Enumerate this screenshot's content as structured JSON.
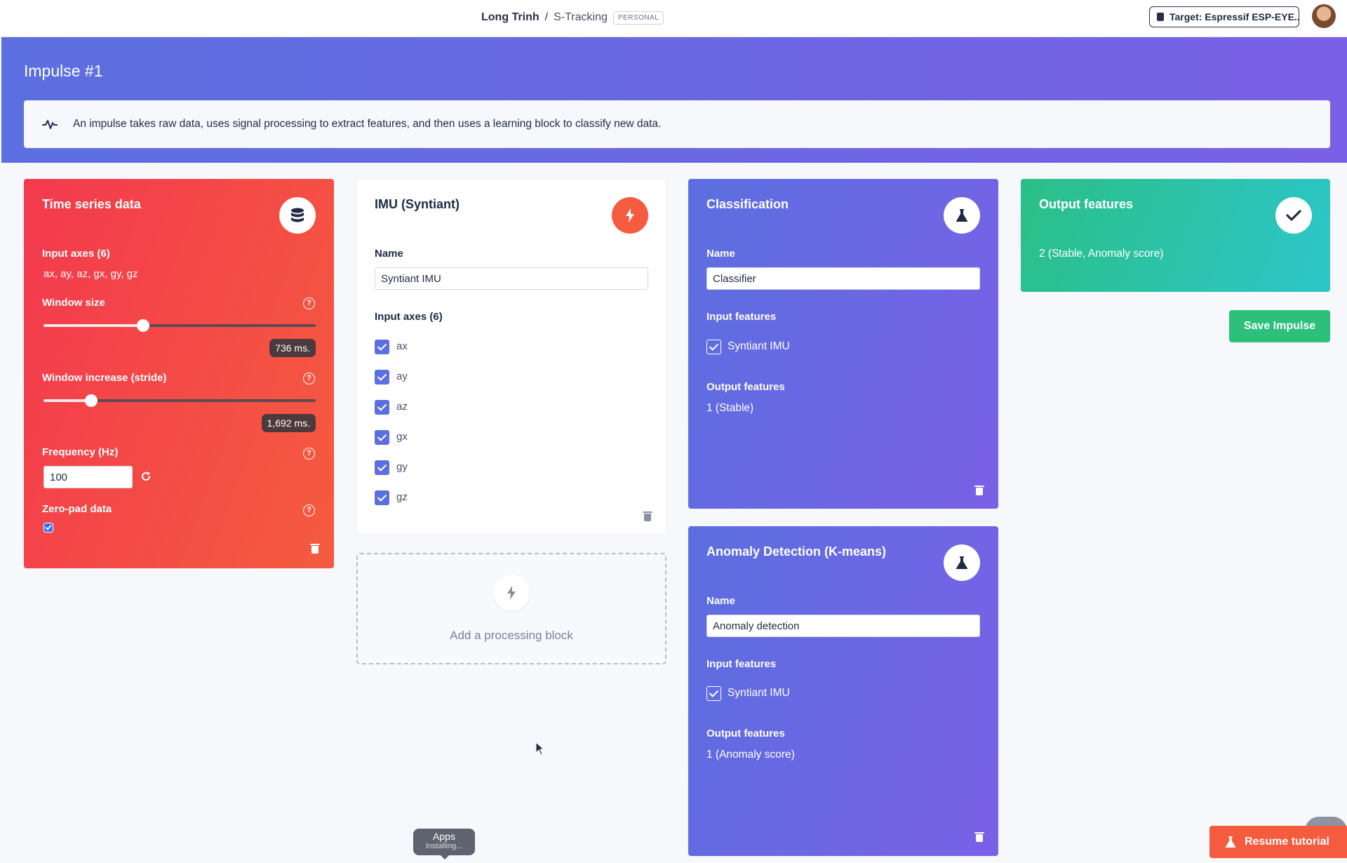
{
  "topbar": {
    "owner": "Long Trinh",
    "separator": "/",
    "project": "S-Tracking",
    "plan_badge": "PERSONAL",
    "target_label": "Target: Espressif ESP-EYE..."
  },
  "header": {
    "title": "Impulse #1",
    "info": "An impulse takes raw data, uses signal processing to extract features, and then uses a learning block to classify new data."
  },
  "time_series": {
    "title": "Time series data",
    "icon": "database-icon",
    "input_axes_label": "Input axes (6)",
    "input_axes_value": "ax, ay, az, gx, gy, gz",
    "window_size_label": "Window size",
    "window_size_value": "736 ms.",
    "window_size_fraction": 0.365,
    "window_increase_label": "Window increase (stride)",
    "window_increase_value": "1,692 ms.",
    "window_increase_fraction": 0.175,
    "frequency_label": "Frequency (Hz)",
    "frequency_value": "100",
    "zero_pad_label": "Zero-pad data",
    "zero_pad_checked": true
  },
  "processing": {
    "title": "IMU (Syntiant)",
    "icon": "bolt-icon",
    "name_label": "Name",
    "name_value": "Syntiant IMU",
    "axes_label": "Input axes (6)",
    "axes": [
      "ax",
      "ay",
      "az",
      "gx",
      "gy",
      "gz"
    ]
  },
  "add_block": {
    "label": "Add a processing block"
  },
  "classification": {
    "title": "Classification",
    "icon": "flask-icon",
    "name_label": "Name",
    "name_value": "Classifier",
    "input_features_label": "Input features",
    "input_feature": "Syntiant IMU",
    "output_features_label": "Output features",
    "output_features_value": "1 (Stable)"
  },
  "anomaly": {
    "title": "Anomaly Detection (K-means)",
    "icon": "flask-icon",
    "name_label": "Name",
    "name_value": "Anomaly detection",
    "input_features_label": "Input features",
    "input_feature": "Syntiant IMU",
    "output_features_label": "Output features",
    "output_features_value": "1 (Anomaly score)"
  },
  "output": {
    "title": "Output features",
    "icon": "check-icon",
    "value": "2 (Stable, Anomaly score)"
  },
  "actions": {
    "save_label": "Save Impulse",
    "resume_label": "Resume tutorial"
  },
  "apps_tooltip": {
    "title": "Apps",
    "status": "Installing..."
  },
  "colors": {
    "accent_purple": "#5b6fe0",
    "accent_violet": "#7a60e6",
    "time_series_red": "#f3394e",
    "time_series_orange": "#f55b3f",
    "output_green": "#2bbf86",
    "output_teal": "#2cc6c9",
    "save_green": "#2cc07a"
  }
}
